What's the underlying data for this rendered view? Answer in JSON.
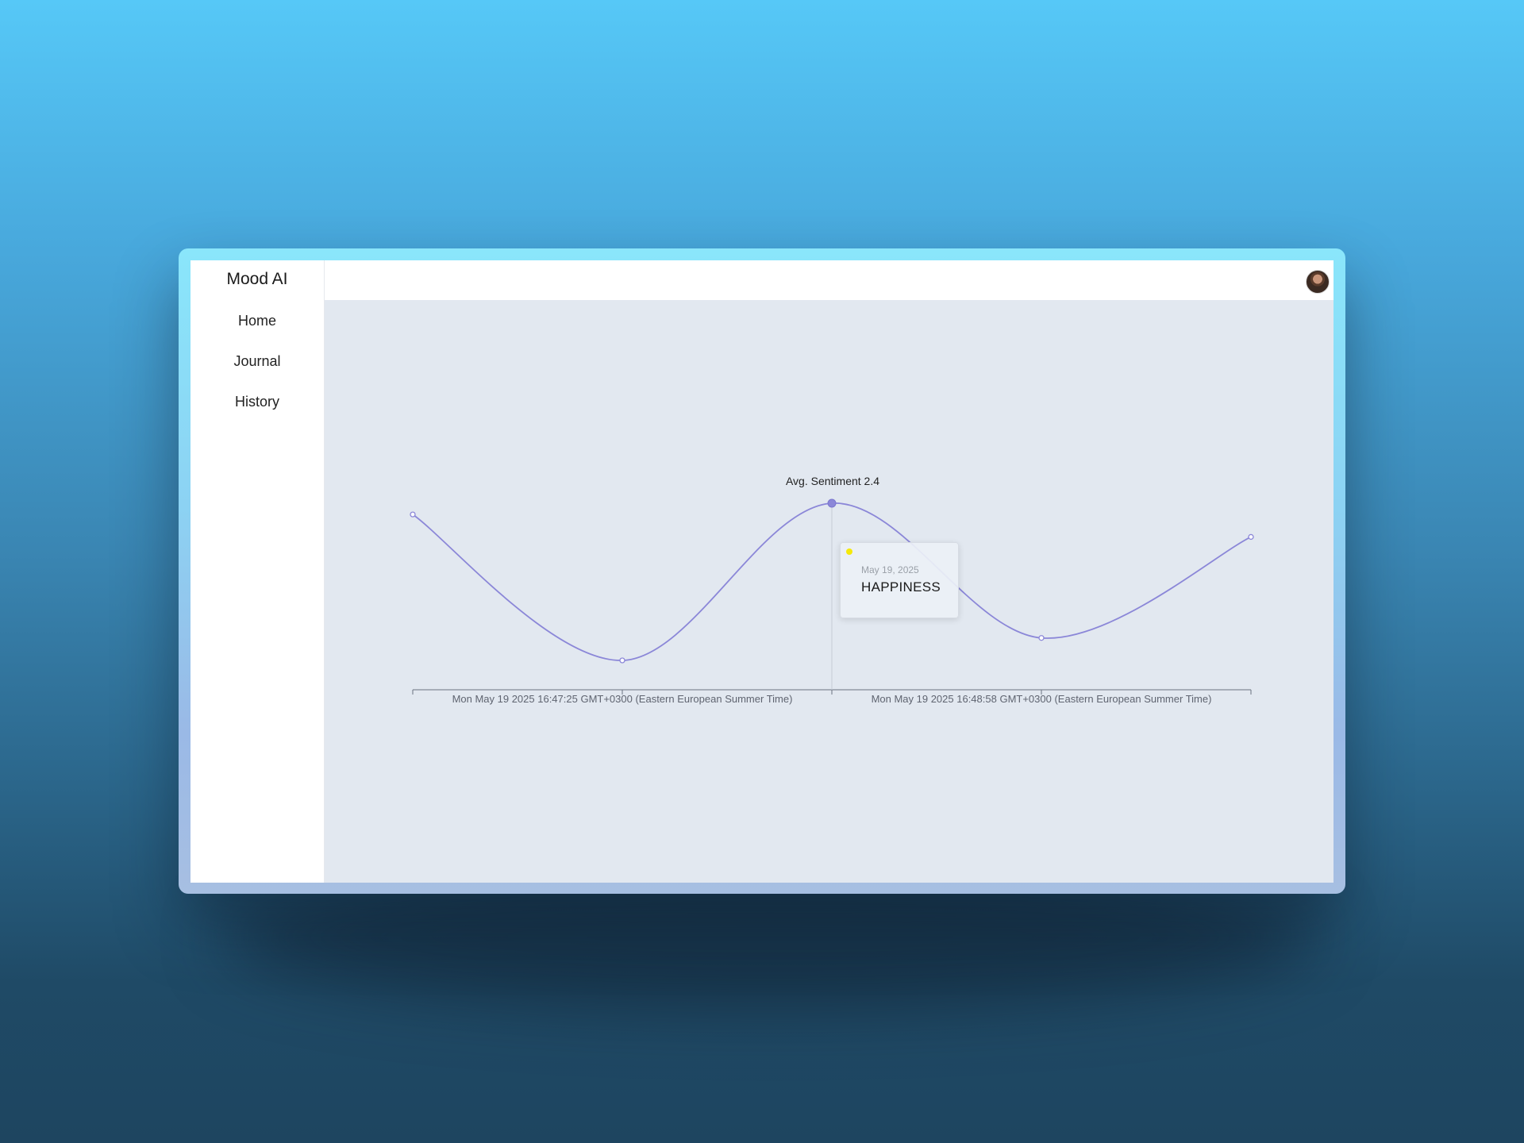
{
  "app": {
    "brand": "Mood AI"
  },
  "sidebar": {
    "items": [
      {
        "label": "Home"
      },
      {
        "label": "Journal"
      },
      {
        "label": "History"
      }
    ]
  },
  "tooltip": {
    "date": "May 19, 2025",
    "mood": "HAPPINESS",
    "dot_color": "#f5e90a"
  },
  "chart_data": {
    "type": "line",
    "title": "Avg. Sentiment 2.4",
    "line_color": "#8b87d8",
    "grid": false,
    "x": [
      "Mon May 19 2025 16:47:25 GMT+0300 (Eastern European Summer Time)",
      "Mon May 19 2025 16:48:58 GMT+0300 (Eastern European Summer Time)"
    ],
    "x_ticks": [
      "Mon May 19 2025 16:47:25 GMT+0300 (Eastern European Summer Time)",
      "Mon May 19 2025 16:48:58 GMT+0300 (Eastern European Summer Time)"
    ],
    "series": [
      {
        "values": [
          6,
          -7,
          7,
          -5,
          4
        ]
      }
    ],
    "active_index": 2
  }
}
